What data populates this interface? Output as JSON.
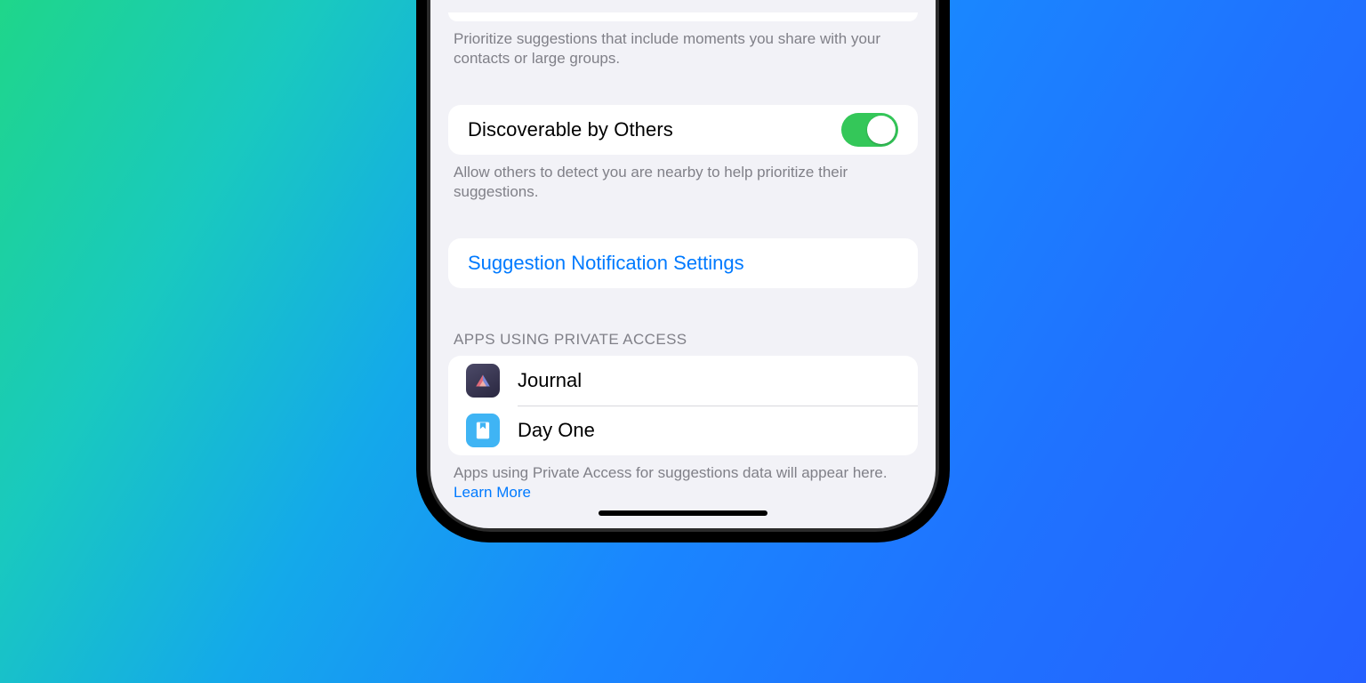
{
  "section1": {
    "footer": "Prioritize suggestions that include moments you share with your contacts or large groups."
  },
  "discoverable": {
    "label": "Discoverable by Others",
    "enabled": true,
    "footer": "Allow others to detect you are nearby to help prioritize their suggestions."
  },
  "notificationSettings": {
    "label": "Suggestion Notification Settings"
  },
  "appsSection": {
    "header": "APPS USING PRIVATE ACCESS",
    "apps": [
      {
        "name": "Journal"
      },
      {
        "name": "Day One"
      }
    ],
    "footer": "Apps using Private Access for suggestions data will appear here. ",
    "learnMore": "Learn More"
  }
}
